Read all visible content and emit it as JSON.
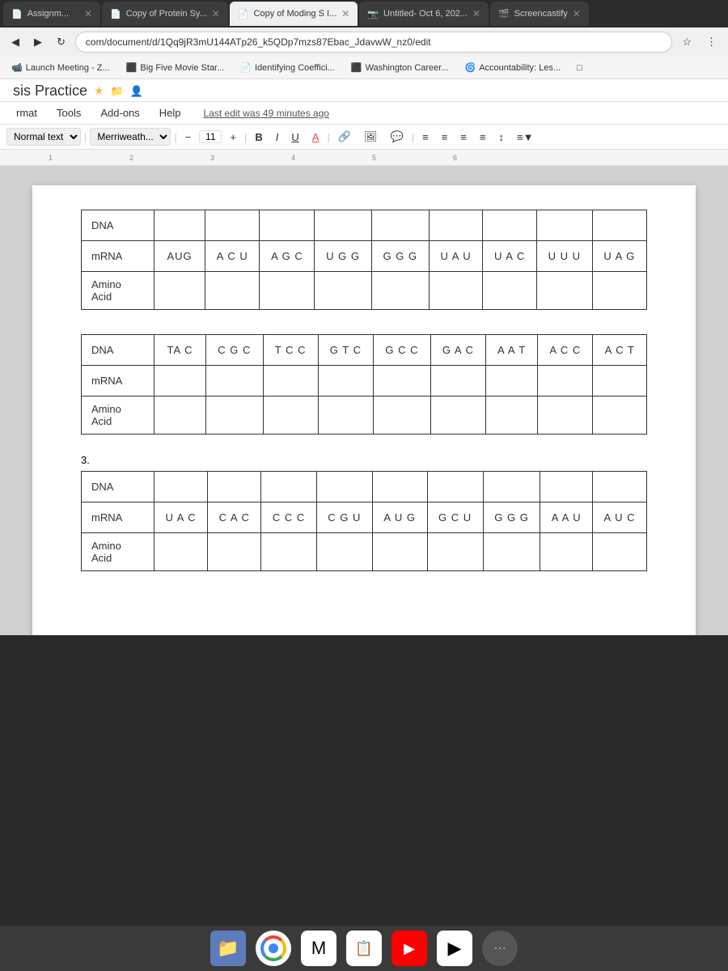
{
  "browser": {
    "tabs": [
      {
        "label": "Assignm...",
        "active": false,
        "icon": "doc"
      },
      {
        "label": "Copy of Protein Sy...",
        "active": false,
        "icon": "doc"
      },
      {
        "label": "Copy of Moding S I...",
        "active": true,
        "icon": "doc"
      },
      {
        "label": "Untitled- Oct 6, 202...",
        "active": false,
        "icon": "doc"
      },
      {
        "label": "Screencastify",
        "active": false,
        "icon": "sc"
      }
    ],
    "address": "com/document/d/1Qq9jR3mU144ATp26_k5QDp7mzs87Ebac_JdavwW_nz0/edit",
    "bookmarks": [
      "Launch Meeting - Z...",
      "Big Five Movie Star...",
      "Identifying Coeffici...",
      "Washington Career...",
      "Accountability: Les..."
    ]
  },
  "document": {
    "title": "sis Practice",
    "title_icons": [
      "star",
      "folder",
      "share"
    ],
    "menu": [
      "rmat",
      "Tools",
      "Add-ons",
      "Help"
    ],
    "last_edit": "Last edit was 49 minutes ago",
    "format": {
      "style": "Normal text",
      "font": "Merriweath...",
      "size": "11",
      "bold": "B",
      "italic": "I",
      "underline": "U",
      "strikethrough": "A"
    }
  },
  "tables": {
    "table1": {
      "rows": [
        {
          "label": "DNA",
          "cells": [
            "",
            "",
            "",
            "",
            "",
            "",
            "",
            "",
            ""
          ]
        },
        {
          "label": "mRNA",
          "cells": [
            "AUG",
            "ACU",
            "AGC",
            "UGG",
            "GGG",
            "UAU",
            "UAC",
            "UUU",
            "UAG"
          ]
        },
        {
          "label": "Amino Acid",
          "cells": [
            "",
            "",
            "",
            "",
            "",
            "",
            "",
            "",
            ""
          ]
        }
      ]
    },
    "table2": {
      "rows": [
        {
          "label": "DNA",
          "cells": [
            "TAC",
            "CGC",
            "TCC",
            "GTC",
            "GCC",
            "GAC",
            "AAT",
            "ACC",
            "ACT"
          ]
        },
        {
          "label": "mRNA",
          "cells": [
            "",
            "",
            "",
            "",
            "",
            "",
            "",
            "",
            ""
          ]
        },
        {
          "label": "Amino Acid",
          "cells": [
            "",
            "",
            "",
            "",
            "",
            "",
            "",
            "",
            ""
          ]
        }
      ]
    },
    "table3": {
      "section_number": "3.",
      "rows": [
        {
          "label": "DNA",
          "cells": [
            "",
            "",
            "",
            "",
            "",
            "",
            "",
            "",
            ""
          ]
        },
        {
          "label": "mRNA",
          "cells": [
            "UAC",
            "CAC",
            "CCC",
            "CGU",
            "AUG",
            "GCU",
            "GGG",
            "AAU",
            "AUC"
          ]
        },
        {
          "label": "Amino Acid",
          "cells": [
            "",
            "",
            "",
            "",
            "",
            "",
            "",
            "",
            ""
          ]
        }
      ]
    }
  },
  "taskbar": {
    "icons": [
      {
        "name": "files-icon",
        "label": "Files"
      },
      {
        "name": "chrome-icon",
        "label": "Chrome"
      },
      {
        "name": "gmail-icon",
        "label": "Gmail"
      },
      {
        "name": "docs-icon",
        "label": "Docs"
      },
      {
        "name": "youtube-icon",
        "label": "YouTube"
      },
      {
        "name": "play-icon",
        "label": "Play"
      },
      {
        "name": "dots-icon",
        "label": "More"
      }
    ]
  }
}
